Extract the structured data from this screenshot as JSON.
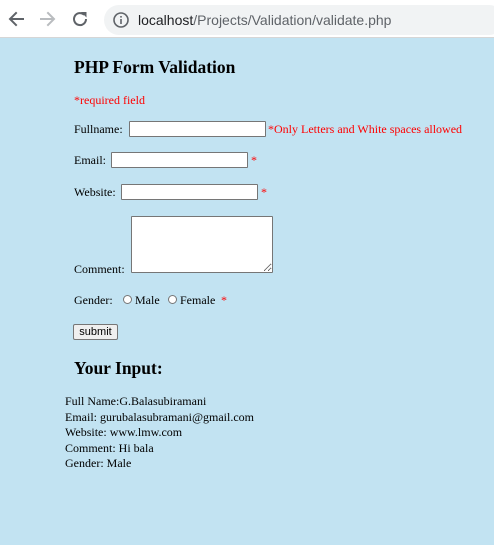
{
  "browser": {
    "url_host": "localhost",
    "url_path": "/Projects/Validation/validate.php"
  },
  "form": {
    "title": "PHP Form Validation",
    "required_note": "*required field",
    "fullname_label": "Fullname:",
    "fullname_value": "",
    "fullname_error": "*Only Letters and White spaces allowed",
    "email_label": "Email:",
    "email_value": "",
    "email_marker": "*",
    "website_label": "Website:",
    "website_value": "",
    "website_marker": "*",
    "comment_label": "Comment:",
    "comment_value": "",
    "gender_label": "Gender:",
    "gender_options": [
      "Male",
      "Female"
    ],
    "gender_selected": null,
    "gender_marker": "*",
    "submit_label": "submit"
  },
  "results": {
    "title": "Your Input:",
    "lines": [
      "Full Name:G.Balasubiramani",
      "Email: gurubalasubramani@gmail.com",
      "Website: www.lmw.com",
      "Comment: Hi bala",
      "Gender: Male"
    ]
  },
  "colors": {
    "page_background": "#c2e3f2",
    "required_red": "#ff0000"
  }
}
